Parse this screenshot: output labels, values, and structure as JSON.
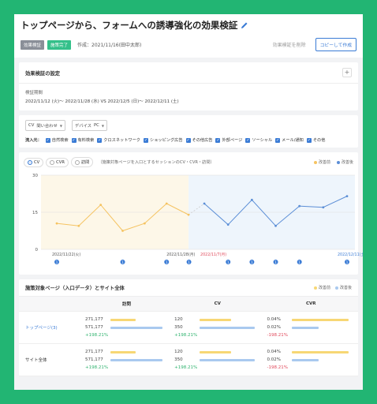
{
  "header": {
    "title": "トップページから、フォームへの誘導強化の効果検証",
    "tag_type": "効果検証",
    "tag_status": "施策完了",
    "created": "作成：2021/11/16(田中太郎)",
    "delete_label": "効果検証を削除",
    "copy_label": "コピーして作成"
  },
  "settings": {
    "title": "効果検証の設定",
    "plus": "+",
    "period_label": "検証期間",
    "period_value": "2022/11/12 (火)〜 2022/11/28 (水) VS 2022/12/5 (日)〜 2022/12/11 (土)"
  },
  "filters": {
    "cv_label": "CV",
    "cv_value": "問い合わせ",
    "device_label": "デバイス",
    "device_value": "PC",
    "inflow_label": "流入元：",
    "sources": [
      "自然検索",
      "有料検索",
      "クロスネットワーク",
      "ショッピング広告",
      "その他広告",
      "外部ページ",
      "ソーシャル",
      "メール/通知",
      "その他"
    ]
  },
  "chart_controls": {
    "radios": [
      "CV",
      "CVR",
      "訪問"
    ],
    "note": "（施策対象ページを入口とするセッションのCV・CVR・訪問）",
    "legend_before": "改善前",
    "legend_after": "改善後"
  },
  "chart_data": {
    "type": "line",
    "ylim": [
      0,
      30
    ],
    "yticks": [
      0,
      15,
      30
    ],
    "xlabels": [
      {
        "text": "2022/11/22(火)",
        "color": "#555555"
      },
      {
        "text": "2022/11/28(月)",
        "color": "#555555"
      },
      {
        "text": "2022/11/7(月)",
        "color": "#e0485a"
      },
      {
        "text": "2022/12/11(土)",
        "color": "#3a7bd5"
      }
    ],
    "series": [
      {
        "name": "改善前",
        "color": "#f5c361",
        "values": [
          10.5,
          9.5,
          18,
          7.5,
          10.5,
          18.5,
          14
        ]
      },
      {
        "name": "改善後",
        "color": "#5b8ed6",
        "values": [
          18.5,
          10,
          20,
          9.5,
          17.5,
          17,
          21.5
        ]
      }
    ],
    "markers": [
      "1",
      "1",
      "1",
      "1",
      "1",
      "1",
      "1",
      "1",
      "1",
      "1"
    ]
  },
  "table": {
    "title": "施策対象ページ（入口データ）とサイト全体",
    "legend_before": "改善前",
    "legend_after": "改善後",
    "columns": [
      "訪問",
      "CV",
      "CVR"
    ],
    "rows": [
      {
        "name": "トップページ(3)",
        "visits": [
          "271,177",
          "571,177",
          "+198.21%"
        ],
        "cv": [
          "120",
          "350",
          "+198.21%"
        ],
        "cvr": [
          "0.04%",
          "0.02%",
          "-198.21%"
        ]
      },
      {
        "name": "サイト全体",
        "visits": [
          "271,177",
          "571,177",
          "+198.21%"
        ],
        "cv": [
          "120",
          "350",
          "+198.21%"
        ],
        "cvr": [
          "0.04%",
          "0.02%",
          "-198.21%"
        ]
      }
    ]
  }
}
